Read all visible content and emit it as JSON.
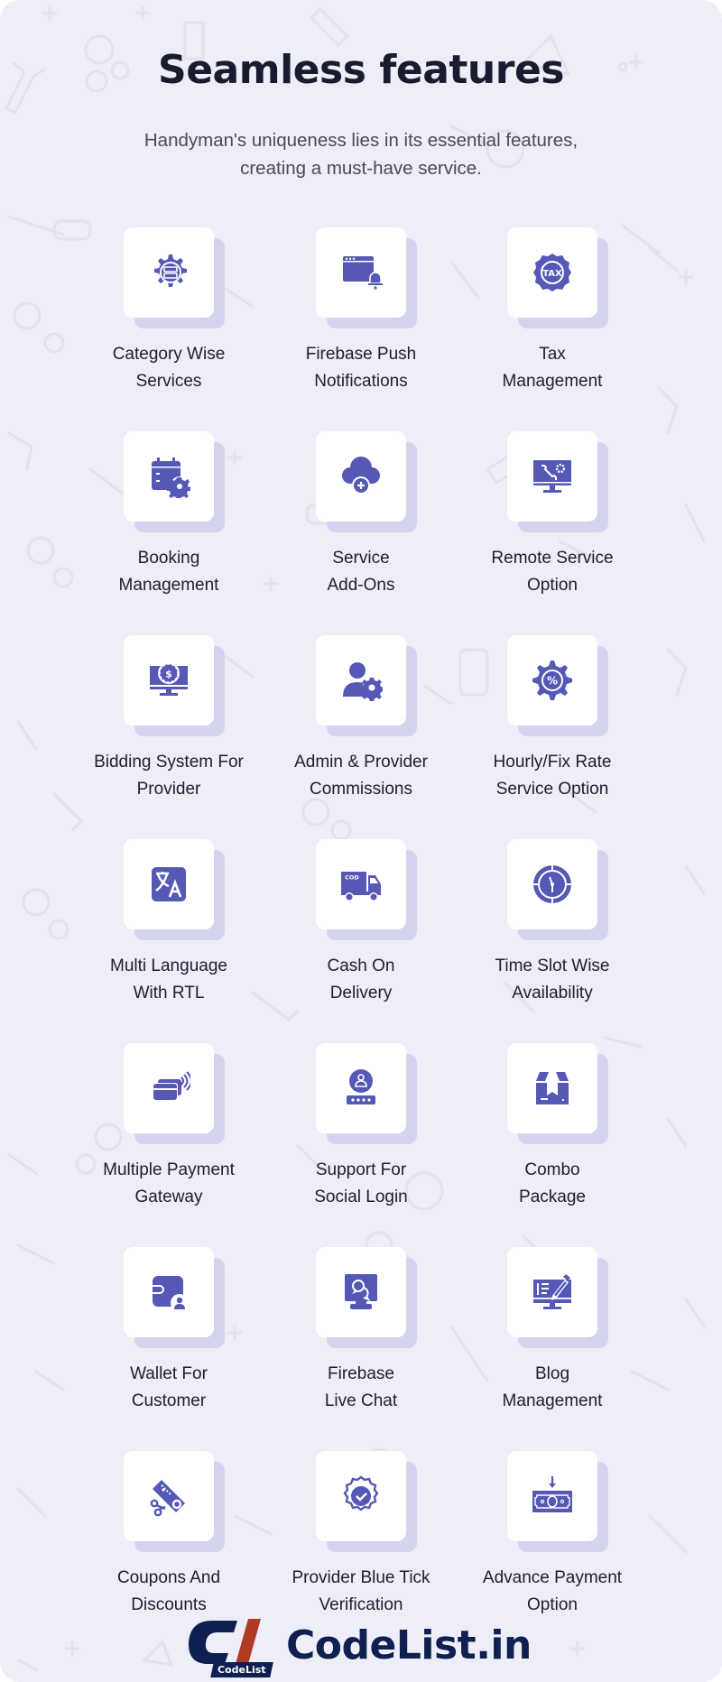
{
  "header": {
    "title": "Seamless features",
    "subtitle_lines": [
      "Handyman's uniqueness lies in its essential features,",
      "creating a must-have service."
    ]
  },
  "theme": {
    "background": "#eeeef8",
    "card": "#ffffff",
    "card_shadow": "#d4d4ee",
    "icon": "#5558b5",
    "title_text": "#1b1b2f",
    "label_text": "#1e1e2c",
    "logo_navy": "#0f1f4f",
    "logo_red": "#b03a22"
  },
  "features": [
    {
      "icon": "gear-list-icon",
      "lines": [
        "Category Wise",
        "Services"
      ]
    },
    {
      "icon": "browser-bell-icon",
      "lines": [
        "Firebase Push",
        "Notifications"
      ]
    },
    {
      "icon": "tax-gear-icon",
      "lines": [
        "Tax",
        "Management"
      ]
    },
    {
      "icon": "calendar-gear-icon",
      "lines": [
        "Booking",
        "Management"
      ]
    },
    {
      "icon": "cloud-plus-icon",
      "lines": [
        "Service",
        "Add-Ons"
      ]
    },
    {
      "icon": "monitor-tools-icon",
      "lines": [
        "Remote Service",
        "Option"
      ]
    },
    {
      "icon": "monitor-dollar-icon",
      "lines": [
        "Bidding System For",
        "Provider"
      ]
    },
    {
      "icon": "user-gear-icon",
      "lines": [
        "Admin & Provider",
        "Commissions"
      ]
    },
    {
      "icon": "gear-percent-icon",
      "lines": [
        "Hourly/Fix Rate",
        "Service Option"
      ]
    },
    {
      "icon": "translate-icon",
      "lines": [
        "Multi Language",
        "With RTL"
      ]
    },
    {
      "icon": "cod-truck-icon",
      "lines": [
        "Cash On",
        "Delivery"
      ]
    },
    {
      "icon": "clock-dial-icon",
      "lines": [
        "Time Slot Wise",
        "Availability"
      ]
    },
    {
      "icon": "contactless-card-icon",
      "lines": [
        "Multiple Payment",
        "Gateway"
      ]
    },
    {
      "icon": "user-password-icon",
      "lines": [
        "Support For",
        "Social Login"
      ]
    },
    {
      "icon": "package-box-icon",
      "lines": [
        "Combo",
        "Package"
      ]
    },
    {
      "icon": "wallet-user-icon",
      "lines": [
        "Wallet For",
        "Customer"
      ]
    },
    {
      "icon": "monitor-chat-icon",
      "lines": [
        "Firebase",
        "Live Chat"
      ]
    },
    {
      "icon": "monitor-edit-icon",
      "lines": [
        "Blog",
        "Management"
      ]
    },
    {
      "icon": "coupon-scissors-icon",
      "lines": [
        "Coupons And",
        "Discounts"
      ]
    },
    {
      "icon": "verified-badge-icon",
      "lines": [
        "Provider Blue Tick",
        "Verification"
      ]
    },
    {
      "icon": "banknote-arrow-icon",
      "lines": [
        "Advance Payment",
        "Option"
      ]
    }
  ],
  "logo": {
    "badge_text": "CodeList",
    "wordmark": "CodeList.in"
  }
}
